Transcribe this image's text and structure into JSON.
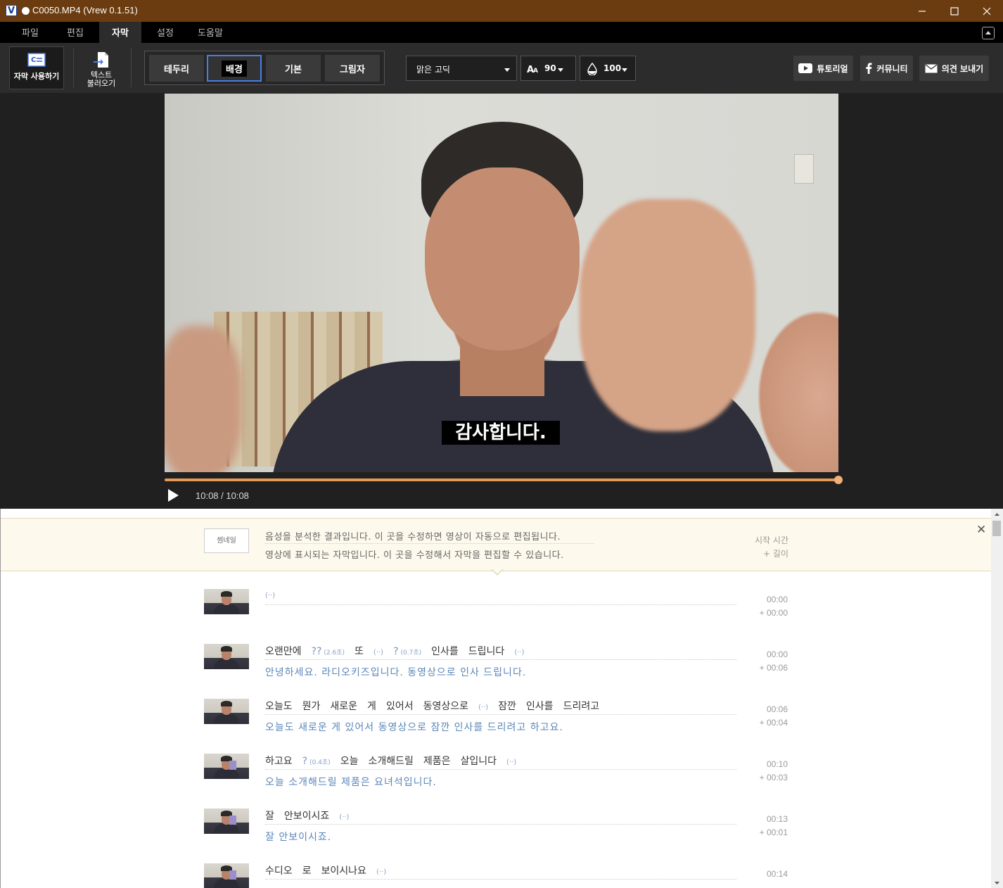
{
  "window": {
    "title": "C0050.MP4 (Vrew 0.1.51)",
    "app_icon": "V"
  },
  "menu": [
    {
      "label": "파일",
      "active": false
    },
    {
      "label": "편집",
      "active": false
    },
    {
      "label": "자막",
      "active": true
    },
    {
      "label": "설정",
      "active": false
    },
    {
      "label": "도움말",
      "active": false
    }
  ],
  "toolbar": {
    "use_subtitle": "자막 사용하기",
    "import_text_1": "텍스트",
    "import_text_2": "불러오기",
    "styles": [
      "테두리",
      "배경",
      "기본",
      "그림자"
    ],
    "active_style": "배경",
    "font": "맑은 고딕",
    "font_size": "90",
    "opacity": "100",
    "tutorial": "튜토리얼",
    "community": "커뮤니티",
    "feedback": "의견 보내기"
  },
  "player": {
    "subtitle": "감사합니다.",
    "time": "10:08 / 10:08",
    "progress": 1.0
  },
  "info": {
    "thumbnail_label": "썸네일",
    "line1": "음성을 분석한 결과입니다. 이 곳을 수정하면 영상이 자동으로 편집됩니다.",
    "line2": "영상에 표시되는 자막입니다. 이 곳을 수정해서 자막을 편집할 수 있습니다.",
    "start_label": "시작 시간",
    "length_label": "+ 길이"
  },
  "rows": [
    {
      "words": [
        {
          "t": "(··)",
          "k": "pause"
        }
      ],
      "edited": "",
      "start": "00:00",
      "dur": "+ 00:00"
    },
    {
      "words": [
        {
          "t": "오랜만에",
          "k": "w"
        },
        {
          "t": "??",
          "s": "(2.6초)",
          "k": "gap"
        },
        {
          "t": "또",
          "k": "w"
        },
        {
          "t": "(··)",
          "k": "pause"
        },
        {
          "t": "?",
          "s": "(0.7초)",
          "k": "gap"
        },
        {
          "t": "인사를",
          "k": "w"
        },
        {
          "t": "드립니다",
          "k": "w"
        },
        {
          "t": "(··)",
          "k": "pause"
        }
      ],
      "edited": "안녕하세요. 라디오키즈입니다. 동영상으로 인사 드립니다.",
      "start": "00:00",
      "dur": "+ 00:06"
    },
    {
      "words": [
        {
          "t": "오늘도",
          "k": "w"
        },
        {
          "t": "뭔가",
          "k": "w"
        },
        {
          "t": "새로운",
          "k": "w"
        },
        {
          "t": "게",
          "k": "w"
        },
        {
          "t": "있어서",
          "k": "w"
        },
        {
          "t": "동영상으로",
          "k": "w"
        },
        {
          "t": "(··)",
          "k": "pause"
        },
        {
          "t": "잠깐",
          "k": "w"
        },
        {
          "t": "인사를",
          "k": "w"
        },
        {
          "t": "드리려고",
          "k": "w"
        }
      ],
      "edited": "오늘도 새로운 게 있어서 동영상으로 잠깐 인사를 드리려고 하고요.",
      "start": "00:06",
      "dur": "+ 00:04"
    },
    {
      "words": [
        {
          "t": "하고요",
          "k": "w"
        },
        {
          "t": "?",
          "s": "(0.4초)",
          "k": "gap"
        },
        {
          "t": "오늘",
          "k": "w"
        },
        {
          "t": "소개해드릴",
          "k": "w"
        },
        {
          "t": "제품은",
          "k": "w"
        },
        {
          "t": "살입니다",
          "k": "w"
        },
        {
          "t": "(··)",
          "k": "pause"
        }
      ],
      "edited": "오늘 소개해드릴 제품은 요녀석입니다.",
      "start": "00:10",
      "dur": "+ 00:03"
    },
    {
      "words": [
        {
          "t": "잘",
          "k": "w"
        },
        {
          "t": "안보이시죠",
          "k": "w"
        },
        {
          "t": "(··)",
          "k": "pause"
        }
      ],
      "edited": "잘 안보이시죠.",
      "start": "00:13",
      "dur": "+ 00:01"
    },
    {
      "words": [
        {
          "t": "수디오",
          "k": "w"
        },
        {
          "t": "로",
          "k": "w"
        },
        {
          "t": "보이시나요",
          "k": "w"
        },
        {
          "t": "(··)",
          "k": "pause"
        }
      ],
      "edited": "",
      "start": "00:14",
      "dur": ""
    }
  ]
}
